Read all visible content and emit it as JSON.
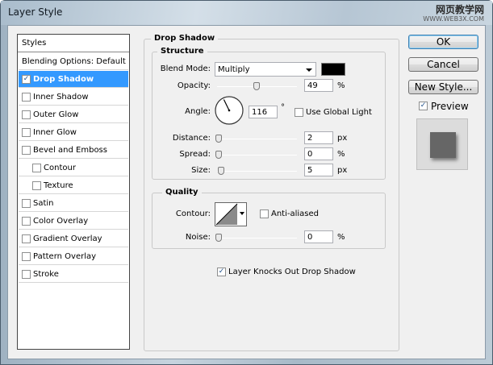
{
  "window": {
    "title": "Layer Style"
  },
  "watermark": {
    "line1": "网页教学网",
    "line2": "WWW.WEB3X.COM"
  },
  "sidebar": {
    "header": "Styles",
    "items": [
      {
        "label": "Blending Options: Default",
        "checkbox": false,
        "checked": false,
        "selected": false,
        "indent": 0
      },
      {
        "label": "Drop Shadow",
        "checkbox": true,
        "checked": true,
        "selected": true,
        "indent": 0
      },
      {
        "label": "Inner Shadow",
        "checkbox": true,
        "checked": false,
        "selected": false,
        "indent": 0
      },
      {
        "label": "Outer Glow",
        "checkbox": true,
        "checked": false,
        "selected": false,
        "indent": 0
      },
      {
        "label": "Inner Glow",
        "checkbox": true,
        "checked": false,
        "selected": false,
        "indent": 0
      },
      {
        "label": "Bevel and Emboss",
        "checkbox": true,
        "checked": false,
        "selected": false,
        "indent": 0
      },
      {
        "label": "Contour",
        "checkbox": true,
        "checked": false,
        "selected": false,
        "indent": 1
      },
      {
        "label": "Texture",
        "checkbox": true,
        "checked": false,
        "selected": false,
        "indent": 1
      },
      {
        "label": "Satin",
        "checkbox": true,
        "checked": false,
        "selected": false,
        "indent": 0
      },
      {
        "label": "Color Overlay",
        "checkbox": true,
        "checked": false,
        "selected": false,
        "indent": 0
      },
      {
        "label": "Gradient Overlay",
        "checkbox": true,
        "checked": false,
        "selected": false,
        "indent": 0
      },
      {
        "label": "Pattern Overlay",
        "checkbox": true,
        "checked": false,
        "selected": false,
        "indent": 0
      },
      {
        "label": "Stroke",
        "checkbox": true,
        "checked": false,
        "selected": false,
        "indent": 0
      }
    ]
  },
  "drop_shadow": {
    "title": "Drop Shadow",
    "structure": {
      "title": "Structure",
      "blend_mode_label": "Blend Mode:",
      "blend_mode_value": "Multiply",
      "shadow_color": "#000000",
      "opacity_label": "Opacity:",
      "opacity_value": "49",
      "opacity_unit": "%",
      "opacity_fraction": 0.49,
      "angle_label": "Angle:",
      "angle_value": "116",
      "angle_unit": "°",
      "angle_degrees": 116,
      "use_global_light_label": "Use Global Light",
      "use_global_light_checked": false,
      "distance_label": "Distance:",
      "distance_value": "2",
      "distance_unit": "px",
      "spread_label": "Spread:",
      "spread_value": "0",
      "spread_unit": "%",
      "size_label": "Size:",
      "size_value": "5",
      "size_unit": "px"
    },
    "quality": {
      "title": "Quality",
      "contour_label": "Contour:",
      "anti_aliased_label": "Anti-aliased",
      "anti_aliased_checked": false,
      "noise_label": "Noise:",
      "noise_value": "0",
      "noise_unit": "%"
    },
    "knockout_label": "Layer Knocks Out Drop Shadow",
    "knockout_checked": true
  },
  "buttons": {
    "ok": "OK",
    "cancel": "Cancel",
    "new_style": "New Style..."
  },
  "preview": {
    "label": "Preview",
    "checked": true
  }
}
